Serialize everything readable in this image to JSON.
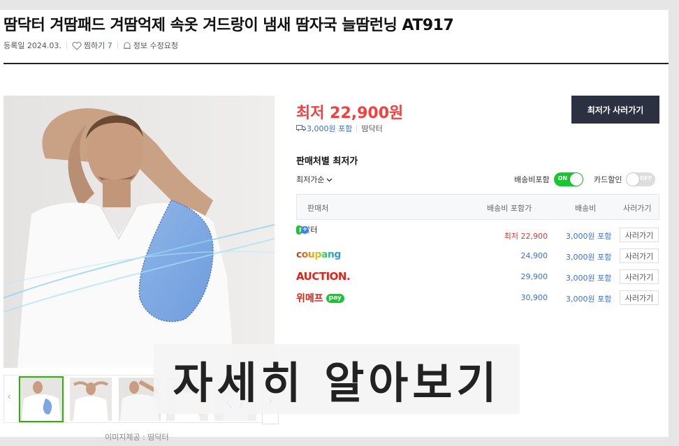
{
  "product": {
    "title": "땀닥터 겨땀패드 겨땀억제 속옷 겨드랑이 냄새 땀자국 늘땀런닝 AT917",
    "registered": "등록일 2024.03.",
    "wishlist_label": "찜하기",
    "wishlist_count": "7",
    "report_label": "정보 수정요청"
  },
  "gallery": {
    "image_credit": "이미지제공 : 땀닥터",
    "thumbnail_count": 5,
    "selected_thumbnail": 1
  },
  "pricing": {
    "lowest_price": "최저 22,900원",
    "shipping": "3,000원 포함",
    "seller": "땀닥터",
    "buy_button": "최저가 사러가기"
  },
  "seller_table": {
    "section_title": "판매처별 최저가",
    "sort_label": "최저가순",
    "toggle_shipping_label": "배송비포함",
    "toggle_shipping_state": "ON",
    "toggle_card_label": "카드할인",
    "toggle_card_state": "OFF",
    "columns": [
      "판매처",
      "배송비 포함가",
      "배송비",
      "사러가기"
    ],
    "rows": [
      {
        "seller": "땀닥터",
        "badge": "pay",
        "price": "최저 22,900",
        "shipping": "3,000원 포함",
        "button": "사러가기"
      },
      {
        "seller": "coupang",
        "price": "24,900",
        "shipping": "3,000원 포함",
        "button": "사러가기"
      },
      {
        "seller": "AUCTION.",
        "price": "29,900",
        "shipping": "3,000원 포함",
        "button": "사러가기"
      },
      {
        "seller": "위메프",
        "badge": "pay",
        "price": "30,900",
        "shipping": "3,000원 포함",
        "button": "사러가기"
      }
    ]
  },
  "overlay": {
    "text": "자세히 알아보기"
  },
  "colors": {
    "price_red": "#f43f3f",
    "link_blue": "#3b6fd8",
    "naver_green": "#16c72f",
    "dark_button": "#2b3140"
  }
}
